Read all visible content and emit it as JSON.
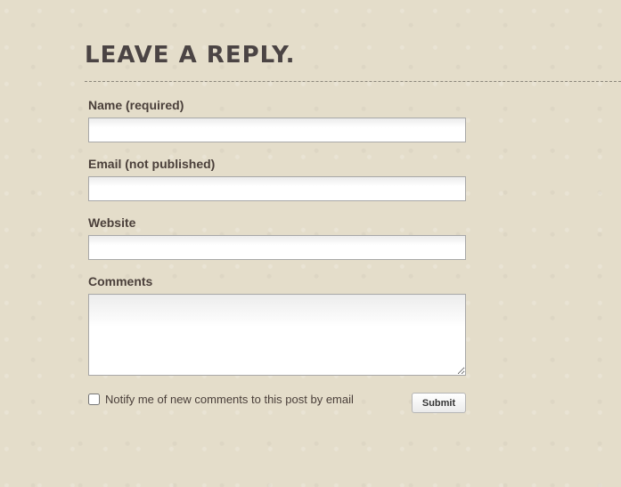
{
  "heading": "LEAVE A REPLY.",
  "form": {
    "name_label": "Name (required)",
    "name_value": "",
    "email_label": "Email (not published)",
    "email_value": "",
    "website_label": "Website",
    "website_value": "",
    "comments_label": "Comments",
    "comments_value": "",
    "notify_label": "Notify me of new comments to this post by email",
    "notify_checked": false,
    "submit_label": "Submit"
  }
}
